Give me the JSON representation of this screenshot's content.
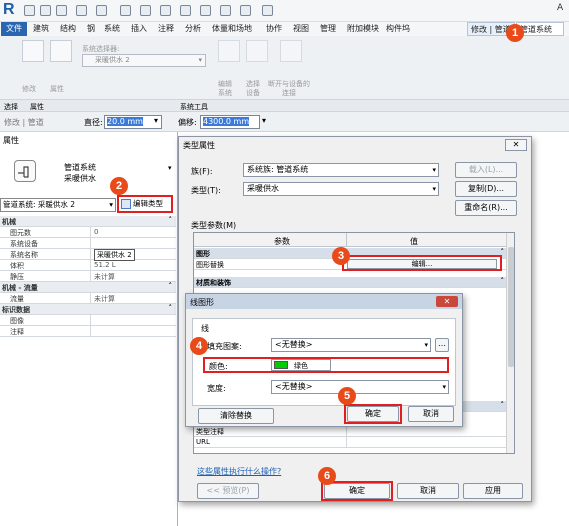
{
  "app": {
    "logo": "R",
    "title_partial": "A"
  },
  "menu": {
    "file": "文件",
    "items": [
      "建筑",
      "结构",
      "钢",
      "系统",
      "插入",
      "注释",
      "分析",
      "体量和场地",
      "协作",
      "视图",
      "管理",
      "附加模块",
      "构件坞"
    ],
    "modify_tab": "修改 | 管道",
    "context_tab": "管道系统"
  },
  "ribbon": {
    "modify_label": "修改",
    "props_label": "属性",
    "system_selector_label": "系统选择器:",
    "system_selector_value": "采暖供水 2",
    "edit_system_label": "编辑\n系统",
    "select_equipment_label": "选择\n设备",
    "disconnect_label": "断开与设备的\n连接"
  },
  "panel_bar": {
    "select": "选择",
    "properties": "属性",
    "system_tools": "系统工具"
  },
  "options_bar": {
    "modify_pipe": "修改 | 管道",
    "diameter_label": "直径:",
    "diameter_value": "20.0 mm",
    "offset_label": "偏移:",
    "offset_value": "4300.0 mm"
  },
  "properties_panel": {
    "title": "属性",
    "type_name": "管道系统",
    "type_sub": "采暖供水",
    "selector": "管道系统: 采暖供水 2",
    "edit_type": "编辑类型",
    "rows": [
      {
        "cat": true,
        "k": "机械"
      },
      {
        "k": "图元数",
        "v": "0"
      },
      {
        "k": "系统设备",
        "v": ""
      },
      {
        "k": "系统名称",
        "v": "采暖供水 2",
        "boxed": true
      },
      {
        "k": "体积",
        "v": "51.2 L"
      },
      {
        "k": "静压",
        "v": "未计算"
      },
      {
        "cat": true,
        "k": "机械 - 流量"
      },
      {
        "k": "流量",
        "v": "未计算"
      },
      {
        "cat": true,
        "k": "标识数据"
      },
      {
        "k": "图像",
        "v": ""
      },
      {
        "k": "注释",
        "v": ""
      }
    ]
  },
  "type_dialog": {
    "title": "类型属性",
    "family_label": "族(F):",
    "family_value": "系统族: 管道系统",
    "type_label": "类型(T):",
    "type_value": "采暖供水",
    "load": "载入(L)...",
    "duplicate": "复制(D)...",
    "rename": "重命名(R)...",
    "params_label": "类型参数(M)",
    "col_param": "参数",
    "col_value": "值",
    "rows": [
      {
        "cat": true,
        "k": "图形"
      },
      {
        "k": "图形替换",
        "v": "编辑..."
      },
      {
        "cat": true,
        "k": "材质和装饰"
      },
      {
        "k": "类型注释"
      },
      {
        "k": "URL"
      }
    ],
    "help_link": "这些属性执行什么操作?",
    "preview": "<< 预览(P)",
    "ok": "确定",
    "cancel": "取消",
    "apply": "应用"
  },
  "line_dialog": {
    "title": "线图形",
    "group": "线",
    "fill_label": "填充图案:",
    "fill_value": "<无替换>",
    "color_label": "颜色:",
    "color_value": "绿色",
    "color_hex": "#00cc00",
    "weight_label": "宽度:",
    "weight_value": "<无替换>",
    "clear": "清除替换",
    "ok": "确定",
    "cancel": "取消"
  },
  "steps": [
    "1",
    "2",
    "3",
    "4",
    "5",
    "6"
  ]
}
